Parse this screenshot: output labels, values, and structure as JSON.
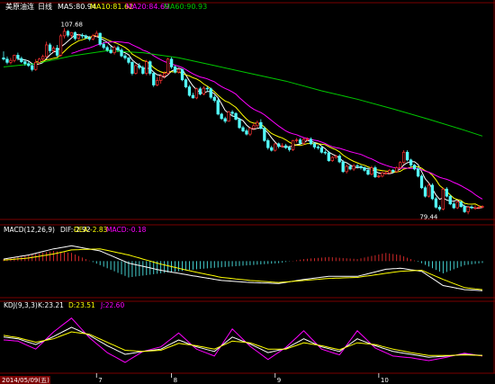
{
  "header": {
    "instrument": "美原油连",
    "period": "日线",
    "ma5_label": "MA5:80.94",
    "ma10_label": "MA10:81.62",
    "ma20_label": "MA20:84.69",
    "ma60_label": "MA60:90.93"
  },
  "macd_header": {
    "title": "MACD(12,26,9)",
    "dif_label": "DIF:-2.92",
    "dea_label": "DEA:-2.83",
    "macd_label": "MACD:-0.18"
  },
  "kdj_header": {
    "title": "KDJ(9,3,3)",
    "k_label": "K:23.21",
    "d_label": "D:23.51",
    "j_label": "J:22.60"
  },
  "annotations": {
    "high": "107.68",
    "low": "79.44"
  },
  "date_axis": {
    "start": "2014/05/09(五)",
    "ticks": [
      "7",
      "8",
      "9",
      "10"
    ]
  },
  "colors": {
    "background": "#000000",
    "up": "#ff3232",
    "down": "#54ffff",
    "ma5": "#ffffff",
    "ma10": "#ffff00",
    "ma20": "#ff00ff",
    "ma60": "#00c800",
    "dif": "#ffffff",
    "dea": "#ffff00",
    "k": "#ffffff",
    "d": "#ffff00",
    "j": "#ff00ff",
    "grid": "#7a0000"
  },
  "chart_data": [
    {
      "type": "candlestick",
      "title": "美原油连 日线",
      "ylim": [
        78,
        110
      ],
      "x": [
        1,
        2,
        3,
        4,
        5,
        6,
        7,
        8,
        9,
        10,
        11,
        12,
        13,
        14,
        15,
        16,
        17,
        18,
        19,
        20,
        21,
        22,
        23,
        24,
        25,
        26,
        27,
        28,
        29,
        30,
        31,
        32,
        33,
        34,
        35,
        36,
        37,
        38,
        39,
        40,
        41,
        42,
        43,
        44,
        45,
        46,
        47,
        48,
        49,
        50,
        51,
        52,
        53,
        54,
        55,
        56,
        57,
        58,
        59,
        60,
        61,
        62,
        63,
        64,
        65,
        66,
        67,
        68,
        69,
        70,
        71,
        72,
        73,
        74,
        75,
        76,
        77,
        78,
        79,
        80,
        81,
        82,
        83,
        84,
        85,
        86,
        87,
        88,
        89,
        90,
        91,
        92,
        93,
        94,
        95,
        96,
        97,
        98,
        99,
        100,
        101,
        102,
        103,
        104,
        105,
        106,
        107,
        108,
        109,
        110,
        111,
        112,
        113,
        114,
        115,
        116,
        117,
        118,
        119,
        120,
        121,
        122,
        123,
        124,
        125,
        126,
        127,
        128,
        129,
        130,
        131,
        132,
        133,
        134,
        135
      ],
      "open": [
        103.0,
        102.8,
        102.3,
        102.6,
        103.4,
        102.9,
        102.4,
        102.1,
        101.8,
        101.2,
        102.3,
        102.8,
        103.2,
        105.0,
        104.1,
        104.5,
        103.4,
        106.4,
        107.1,
        106.5,
        106.9,
        106.0,
        106.5,
        106.4,
        106.1,
        105.9,
        106.4,
        106.8,
        105.1,
        104.6,
        104.2,
        103.8,
        104.6,
        104.2,
        103.3,
        103.0,
        102.3,
        100.6,
        101.8,
        101.5,
        100.6,
        102.4,
        100.6,
        98.8,
        99.5,
        100.2,
        100.6,
        102.8,
        101.6,
        100.8,
        101.2,
        99.6,
        98.5,
        97.2,
        96.8,
        98.2,
        97.4,
        98.3,
        98.2,
        96.9,
        96.4,
        94.3,
        93.6,
        93.2,
        94.6,
        94.4,
        93.5,
        92.2,
        91.7,
        91.2,
        92.1,
        92.5,
        93.0,
        92.1,
        90.2,
        89.1,
        88.7,
        89.7,
        89.3,
        89.4,
        89.1,
        88.8,
        90.2,
        90.3,
        89.8,
        90.4,
        90.4,
        89.7,
        89.2,
        89.1,
        88.4,
        88.3,
        87.1,
        87.6,
        87.8,
        86.9,
        85.4,
        86.2,
        85.8,
        86.3,
        86.2,
        86.0,
        85.6,
        85.0,
        86.0,
        84.6,
        84.7,
        85.2,
        85.2,
        85.6,
        85.4,
        86.0,
        86.8,
        88.4,
        87.2,
        86.4,
        85.8,
        84.7,
        82.9,
        81.6,
        83.3,
        81.2,
        79.9,
        79.6,
        82.7,
        81.6,
        80.4,
        79.8,
        80.7,
        80.0,
        79.2,
        79.9,
        79.8,
        79.8,
        79.9
      ],
      "high": [
        104.0,
        103.2,
        103.0,
        103.5,
        103.8,
        103.2,
        102.8,
        102.5,
        102.2,
        102.8,
        103.0,
        103.5,
        105.5,
        105.3,
        104.8,
        105.0,
        106.7,
        107.6,
        107.3,
        107.0,
        107.1,
        106.7,
        106.8,
        106.6,
        106.4,
        106.7,
        107.2,
        106.9,
        105.5,
        104.9,
        104.8,
        104.9,
        104.9,
        104.5,
        103.6,
        103.1,
        102.5,
        102.0,
        102.2,
        101.8,
        102.7,
        102.6,
        100.9,
        100.0,
        100.5,
        100.9,
        103.0,
        103.1,
        101.8,
        101.3,
        101.3,
        99.8,
        98.8,
        97.6,
        98.4,
        98.5,
        98.6,
        98.6,
        98.4,
        97.2,
        96.7,
        94.5,
        93.9,
        94.8,
        94.9,
        94.6,
        93.7,
        92.5,
        92.0,
        92.3,
        92.9,
        93.3,
        93.5,
        92.4,
        90.5,
        89.4,
        89.8,
        89.9,
        89.8,
        89.7,
        89.4,
        90.3,
        90.6,
        90.6,
        90.6,
        90.7,
        90.7,
        89.9,
        89.5,
        89.4,
        88.7,
        88.6,
        87.8,
        88.0,
        88.1,
        87.2,
        86.5,
        86.5,
        86.6,
        86.6,
        86.4,
        86.2,
        86.0,
        86.3,
        86.3,
        85.0,
        85.4,
        85.5,
        85.8,
        85.8,
        86.2,
        87.0,
        88.7,
        88.7,
        87.4,
        86.6,
        86.1,
        85.0,
        83.2,
        83.6,
        83.6,
        81.5,
        80.2,
        82.9,
        83.0,
        81.8,
        80.7,
        80.9,
        80.9,
        80.3,
        80.1,
        80.2,
        80.2,
        80.2,
        80.2
      ],
      "low": [
        102.6,
        102.0,
        102.0,
        102.3,
        102.6,
        102.2,
        101.8,
        101.6,
        100.9,
        101.0,
        102.0,
        102.5,
        103.0,
        103.7,
        103.8,
        103.1,
        103.2,
        106.0,
        106.2,
        106.1,
        105.7,
        105.8,
        106.0,
        105.9,
        105.6,
        105.7,
        106.2,
        104.8,
        104.3,
        103.9,
        103.6,
        103.5,
        103.9,
        103.1,
        102.7,
        102.0,
        100.3,
        100.4,
        101.2,
        100.4,
        100.3,
        100.3,
        98.5,
        98.6,
        99.0,
        99.8,
        100.4,
        101.3,
        100.6,
        100.6,
        99.4,
        98.3,
        97.0,
        96.7,
        96.6,
        97.2,
        97.2,
        97.8,
        96.6,
        96.1,
        94.1,
        93.4,
        92.9,
        93.1,
        93.9,
        93.3,
        92.0,
        91.5,
        91.0,
        90.9,
        91.8,
        92.2,
        91.9,
        90.0,
        88.8,
        88.5,
        88.5,
        89.0,
        89.1,
        88.9,
        88.5,
        88.6,
        89.9,
        89.6,
        89.5,
        90.1,
        89.5,
        88.9,
        88.8,
        88.2,
        88.0,
        86.9,
        86.9,
        87.4,
        86.7,
        85.2,
        85.1,
        85.6,
        85.5,
        85.9,
        85.7,
        85.4,
        84.8,
        84.8,
        84.4,
        84.4,
        84.5,
        84.9,
        85.0,
        85.2,
        85.2,
        85.8,
        86.6,
        87.0,
        86.1,
        85.6,
        84.5,
        82.7,
        81.4,
        81.4,
        81.0,
        79.7,
        79.3,
        79.4,
        81.4,
        80.2,
        79.6,
        79.6,
        79.8,
        79.0,
        78.8,
        79.6,
        79.5,
        79.6,
        79.7
      ],
      "close": [
        102.8,
        102.3,
        102.6,
        103.4,
        102.9,
        102.4,
        102.1,
        101.8,
        101.2,
        102.3,
        102.8,
        103.2,
        105.0,
        104.1,
        104.5,
        103.4,
        106.4,
        107.1,
        106.5,
        106.9,
        106.0,
        106.5,
        106.4,
        106.1,
        105.9,
        106.4,
        106.8,
        105.1,
        104.6,
        104.2,
        103.8,
        104.6,
        104.2,
        103.3,
        103.0,
        102.3,
        100.6,
        101.8,
        101.5,
        100.6,
        102.4,
        100.6,
        98.8,
        99.5,
        100.2,
        100.6,
        102.8,
        101.6,
        100.8,
        101.2,
        99.6,
        98.5,
        97.2,
        96.8,
        98.2,
        97.4,
        98.3,
        98.2,
        96.9,
        96.4,
        94.3,
        93.6,
        93.2,
        94.6,
        94.4,
        93.5,
        92.2,
        91.7,
        91.2,
        92.1,
        92.5,
        93.0,
        92.1,
        90.2,
        89.1,
        88.7,
        89.7,
        89.3,
        89.4,
        89.1,
        88.8,
        90.2,
        90.3,
        89.8,
        90.4,
        90.4,
        89.7,
        89.2,
        89.1,
        88.4,
        88.3,
        87.1,
        87.6,
        87.8,
        86.9,
        85.4,
        86.2,
        85.8,
        86.3,
        86.2,
        86.0,
        85.6,
        85.0,
        86.0,
        84.6,
        84.7,
        85.2,
        85.2,
        85.6,
        85.4,
        86.0,
        86.8,
        88.4,
        87.2,
        86.4,
        85.8,
        84.7,
        82.9,
        81.6,
        83.3,
        81.2,
        79.9,
        79.6,
        82.7,
        81.6,
        80.4,
        79.8,
        80.7,
        80.0,
        79.2,
        79.9,
        79.8,
        79.8,
        79.9,
        80.0
      ],
      "annotations": [
        {
          "text": "107.68",
          "x": 18,
          "y": 107.6
        },
        {
          "text": "79.44",
          "x": 124,
          "y": 79.44
        }
      ],
      "overlays": [
        "MA5",
        "MA10",
        "MA20",
        "MA60"
      ],
      "ma_values": {
        "MA5": 80.94,
        "MA10": 81.62,
        "MA20": 84.69,
        "MA60": 90.93
      },
      "ma60": {
        "x": [
          1,
          10,
          20,
          30,
          40,
          50,
          60,
          70,
          80,
          90,
          100,
          110,
          120,
          130,
          135
        ],
        "values": [
          101.6,
          102.1,
          103.3,
          104.1,
          103.8,
          103.0,
          101.8,
          100.6,
          99.4,
          97.9,
          96.6,
          95.1,
          93.5,
          91.8,
          90.9
        ]
      }
    },
    {
      "type": "line+bar",
      "title": "MACD(12,26,9)",
      "series": [
        {
          "name": "DIF",
          "type": "line",
          "x": [
            1,
            8,
            15,
            20,
            28,
            36,
            45,
            55,
            62,
            70,
            78,
            85,
            92,
            100,
            108,
            112,
            118,
            124,
            130,
            135
          ],
          "values": [
            0.2,
            0.6,
            1.2,
            1.5,
            1.0,
            -0.2,
            -0.9,
            -1.5,
            -1.9,
            -2.1,
            -2.2,
            -1.8,
            -1.5,
            -1.5,
            -0.8,
            -0.7,
            -1.0,
            -2.4,
            -2.8,
            -2.9
          ]
        },
        {
          "name": "DEA",
          "type": "line",
          "x": [
            1,
            8,
            15,
            20,
            28,
            36,
            45,
            55,
            62,
            70,
            78,
            85,
            92,
            100,
            108,
            112,
            118,
            124,
            130,
            135
          ],
          "values": [
            0.1,
            0.3,
            0.7,
            1.1,
            1.2,
            0.6,
            -0.3,
            -1.1,
            -1.6,
            -1.9,
            -2.1,
            -1.9,
            -1.7,
            -1.6,
            -1.2,
            -1.0,
            -0.9,
            -1.8,
            -2.6,
            -2.8
          ]
        },
        {
          "name": "MACD",
          "type": "bar",
          "x": [
            1,
            8,
            15,
            20,
            28,
            36,
            45,
            55,
            62,
            70,
            78,
            85,
            92,
            100,
            108,
            112,
            118,
            124,
            130,
            135
          ],
          "values": [
            0.2,
            0.6,
            1.0,
            0.8,
            -0.4,
            -1.6,
            -1.2,
            -0.8,
            -0.6,
            -0.4,
            -0.2,
            0.2,
            0.4,
            0.2,
            0.8,
            0.6,
            -0.2,
            -1.2,
            -0.4,
            -0.18
          ]
        }
      ],
      "ylim": [
        -3.5,
        2.5
      ]
    },
    {
      "type": "line",
      "title": "KDJ(9,3,3)",
      "series": [
        {
          "name": "K",
          "x": [
            1,
            5,
            10,
            15,
            20,
            25,
            30,
            35,
            40,
            45,
            50,
            55,
            60,
            65,
            70,
            75,
            80,
            85,
            90,
            95,
            100,
            105,
            110,
            115,
            120,
            125,
            130,
            135
          ],
          "values": [
            55,
            52,
            42,
            56,
            72,
            58,
            40,
            25,
            30,
            34,
            50,
            38,
            30,
            55,
            43,
            28,
            35,
            52,
            38,
            30,
            52,
            40,
            30,
            25,
            20,
            22,
            25,
            23
          ]
        },
        {
          "name": "D",
          "x": [
            1,
            5,
            10,
            15,
            20,
            25,
            30,
            35,
            40,
            45,
            50,
            55,
            60,
            65,
            70,
            75,
            80,
            85,
            90,
            95,
            100,
            105,
            110,
            115,
            120,
            125,
            130,
            135
          ],
          "values": [
            58,
            54,
            46,
            52,
            64,
            60,
            46,
            32,
            30,
            32,
            44,
            40,
            34,
            48,
            45,
            34,
            34,
            45,
            40,
            33,
            45,
            42,
            34,
            28,
            23,
            23,
            24,
            23
          ]
        },
        {
          "name": "J",
          "x": [
            1,
            5,
            10,
            15,
            20,
            25,
            30,
            35,
            40,
            45,
            50,
            55,
            60,
            65,
            70,
            75,
            80,
            85,
            90,
            95,
            100,
            105,
            110,
            115,
            120,
            125,
            130,
            135
          ],
          "values": [
            50,
            48,
            34,
            64,
            88,
            54,
            28,
            11,
            30,
            38,
            62,
            34,
            22,
            69,
            39,
            16,
            37,
            66,
            34,
            24,
            66,
            36,
            22,
            19,
            14,
            20,
            27,
            22
          ]
        }
      ],
      "ylim": [
        0,
        100
      ]
    }
  ]
}
